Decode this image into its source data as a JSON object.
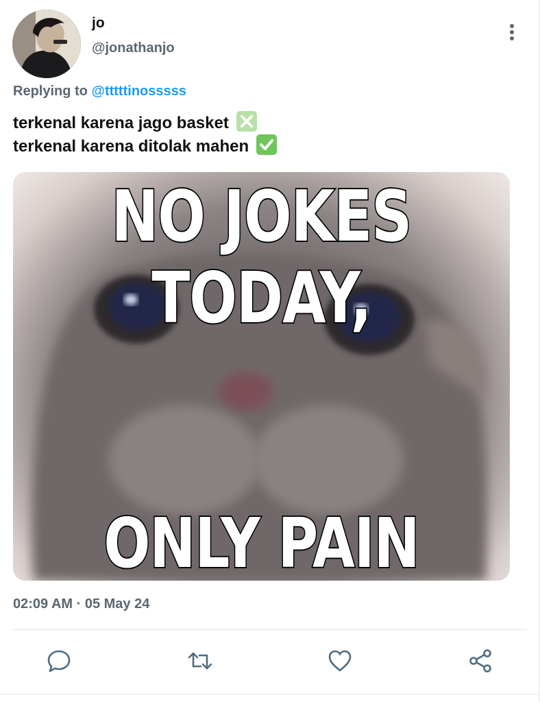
{
  "author": {
    "display_name": "jo",
    "handle": "@jonathanjo",
    "avatar_icon": "profile-photo"
  },
  "reply": {
    "prefix": "Replying to",
    "mention": "@tttttinosssss"
  },
  "tweet": {
    "line1": "terkenal karena jago basket",
    "line1_emoji": "cross-mark-emoji",
    "line2": "terkenal karena ditolak mahen",
    "line2_emoji": "check-mark-emoji"
  },
  "media": {
    "top_caption": "NO JOKES TODAY,",
    "bottom_caption": "ONLY PAIN"
  },
  "timestamp": "02:09 AM · 05 May 24",
  "actions": [
    {
      "name": "reply",
      "icon": "speech-bubble-icon"
    },
    {
      "name": "retweet",
      "icon": "retweet-icon"
    },
    {
      "name": "like",
      "icon": "heart-icon"
    },
    {
      "name": "share",
      "icon": "share-icon"
    }
  ],
  "colors": {
    "mention": "#1d9bf0",
    "muted": "#5b6670",
    "icon": "#4f6b80"
  }
}
